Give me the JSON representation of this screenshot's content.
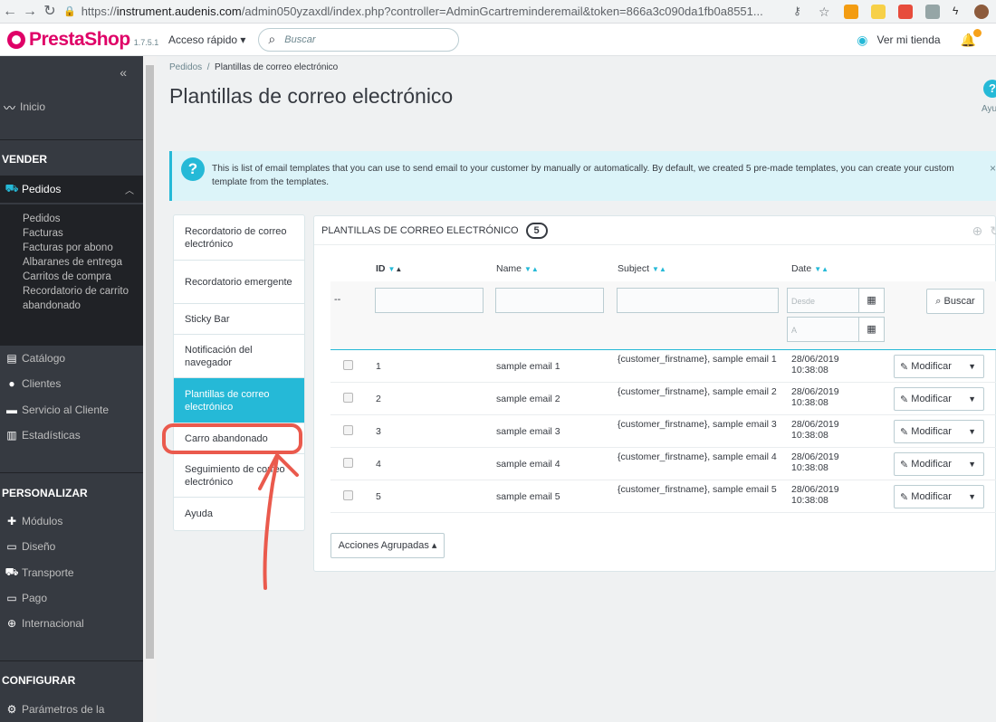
{
  "browser": {
    "url_prefix": "https://",
    "url_host": "instrument.audenis.com",
    "url_rest": "/admin050yzaxdl/index.php?controller=AdminGcartreminderemail&token=866a3c090da1fb0a8551..."
  },
  "header": {
    "logo": "PrestaShop",
    "version": "1.7.5.1",
    "quick_access": "Acceso rápido ▾",
    "search_placeholder": "Buscar",
    "view_shop": "Ver mi tienda"
  },
  "sidebar": {
    "collapse": "«",
    "dashboard": "Inicio",
    "sections": {
      "sell": "VENDER",
      "customize": "PERSONALIZAR",
      "configure": "CONFIGURAR"
    },
    "orders": "Pedidos",
    "orders_sub": [
      "Pedidos",
      "Facturas",
      "Facturas por abono",
      "Albaranes de entrega",
      "Carritos de compra",
      "Recordatorio de carrito",
      "abandonado"
    ],
    "sell_items": [
      "Catálogo",
      "Clientes",
      "Servicio al Cliente",
      "Estadísticas"
    ],
    "customize_items": [
      "Módulos",
      "Diseño",
      "Transporte",
      "Pago",
      "Internacional"
    ],
    "configure_items": [
      "Parámetros de la"
    ]
  },
  "breadcrumb": {
    "parent": "Pedidos",
    "sep": "/",
    "current": "Plantillas de correo electrónico"
  },
  "page_title": "Plantillas de correo electrónico",
  "help_label": "Ayu",
  "alert": {
    "message": "This is list of email templates that you can use to send email to your customer by manually or automatically. By default, we created 5 pre-made templates, you can create your custom template from the templates."
  },
  "tabs": [
    {
      "label": "Recordatorio de correo electrónico"
    },
    {
      "label": "Recordatorio emergente"
    },
    {
      "label": "Sticky Bar"
    },
    {
      "label": "Notificación del navegador"
    },
    {
      "label": "Plantillas de correo electrónico"
    },
    {
      "label": "Carro abandonado"
    },
    {
      "label": "Seguimiento de correo electrónico"
    },
    {
      "label": "Ayuda"
    }
  ],
  "table": {
    "title": "PLANTILLAS DE CORREO ELECTRÓNICO",
    "count": "5",
    "columns": [
      "ID",
      "Name",
      "Subject",
      "Date"
    ],
    "filter_dash": "--",
    "date_from_placeholder": "Desde",
    "date_to_placeholder": "A",
    "search_label": "Buscar",
    "rows": [
      {
        "id": "1",
        "name": "sample email 1",
        "subject": "{customer_firstname}, sample email 1",
        "date": "28/06/2019",
        "time": "10:38:08"
      },
      {
        "id": "2",
        "name": "sample email 2",
        "subject": "{customer_firstname}, sample email 2",
        "date": "28/06/2019",
        "time": "10:38:08"
      },
      {
        "id": "3",
        "name": "sample email 3",
        "subject": "{customer_firstname}, sample email 3",
        "date": "28/06/2019",
        "time": "10:38:08"
      },
      {
        "id": "4",
        "name": "sample email 4",
        "subject": "{customer_firstname}, sample email 4",
        "date": "28/06/2019",
        "time": "10:38:08"
      },
      {
        "id": "5",
        "name": "sample email 5",
        "subject": "{customer_firstname}, sample email 5",
        "date": "28/06/2019",
        "time": "10:38:08"
      }
    ],
    "edit_label": "Modificar",
    "bulk_label": "Acciones Agrupadas ▴"
  },
  "colors": {
    "accent": "#25b9d7",
    "brand": "#df0067",
    "sidebar": "#363a41",
    "annotation": "#ea5a4d"
  }
}
